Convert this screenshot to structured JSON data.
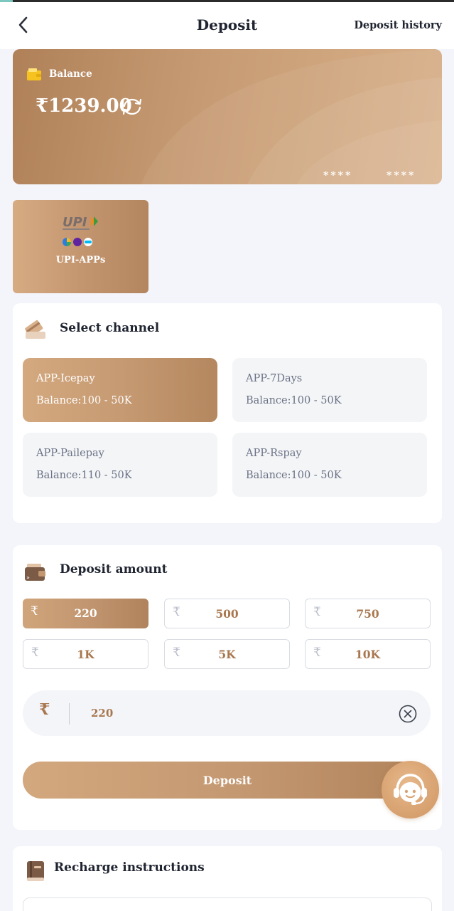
{
  "header": {
    "title": "Deposit",
    "history_label": "Deposit history"
  },
  "balance": {
    "label": "Balance",
    "amount": "₹1239.00",
    "masked_left": "****",
    "masked_right": "****"
  },
  "payment_method": {
    "logo_text": "UPI",
    "label": "UPI-APPs"
  },
  "channels": {
    "title": "Select channel",
    "items": [
      {
        "name": "APP-Icepay",
        "range": "Balance:100 - 50K",
        "selected": true
      },
      {
        "name": "APP-7Days",
        "range": "Balance:100 - 50K",
        "selected": false
      },
      {
        "name": "APP-Pailepay",
        "range": "Balance:110 - 50K",
        "selected": false
      },
      {
        "name": "APP-Rspay",
        "range": "Balance:100 - 50K",
        "selected": false
      }
    ]
  },
  "amount": {
    "title": "Deposit amount",
    "currency_symbol": "₹",
    "presets": [
      "220",
      "500",
      "750",
      "1K",
      "5K",
      "10K"
    ],
    "selected_preset": "220",
    "input_value": "220",
    "button_label": "Deposit"
  },
  "instructions": {
    "title": "Recharge instructions"
  },
  "colors": {
    "accent": "#c39770",
    "accent_dark": "#a8774f",
    "page_bg": "#f4f5fb"
  },
  "icons": [
    "back-chevron-icon",
    "wallet-icon",
    "refresh-icon",
    "card-icon",
    "purse-icon",
    "clear-icon",
    "support-agent-icon",
    "book-icon"
  ]
}
